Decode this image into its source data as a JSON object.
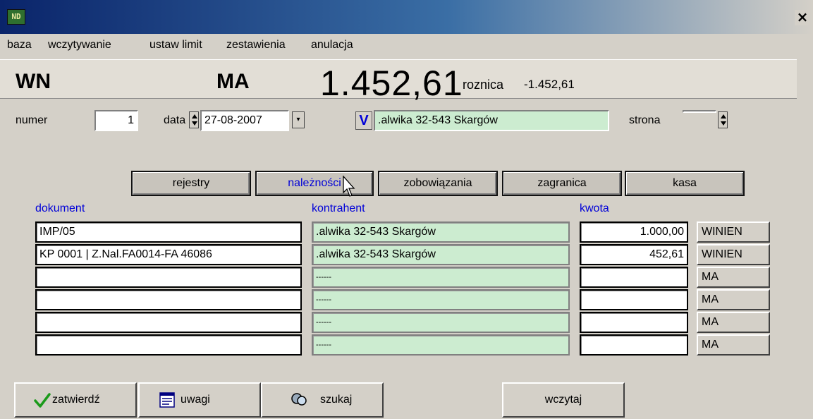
{
  "window": {
    "app_icon_text": "ND",
    "close_glyph": "×"
  },
  "menu": [
    "baza",
    "wczytywanie",
    "ustaw limit",
    "zestawienia",
    "anulacja"
  ],
  "header": {
    "wn_label": "WN",
    "ma_label": "MA",
    "total": "1.452,61",
    "roznica_label": "roznica",
    "roznica_value": "-1.452,61"
  },
  "form": {
    "numer_label": "numer",
    "numer_value": "1",
    "data_label": "data",
    "data_value": "27-08-2007",
    "v_button": "V",
    "kontrahent_value": ".alwika  32-543 Skargów",
    "strona_label": "strona",
    "strona_value": ""
  },
  "tabs": [
    "rejestry",
    "należności",
    "zobowiązania",
    "zagranica",
    "kasa"
  ],
  "columns": {
    "dokument": "dokument",
    "kontrahent": "kontrahent",
    "kwota": "kwota"
  },
  "rows": [
    {
      "dokument": "IMP/05",
      "kontrahent": ".alwika  32-543 Skargów",
      "kwota": "1.000,00",
      "side": "WINIEN"
    },
    {
      "dokument": "KP 0001 | Z.Nal.FA0014-FA 46086",
      "kontrahent": ".alwika  32-543 Skargów",
      "kwota": "452,61",
      "side": "WINIEN"
    },
    {
      "dokument": "",
      "kontrahent": "------",
      "kwota": "",
      "side": "MA"
    },
    {
      "dokument": "",
      "kontrahent": "------",
      "kwota": "",
      "side": "MA"
    },
    {
      "dokument": "",
      "kontrahent": "------",
      "kwota": "",
      "side": "MA"
    },
    {
      "dokument": "",
      "kontrahent": "------",
      "kwota": "",
      "side": "MA"
    }
  ],
  "buttons": {
    "zatwierdz": "zatwierdź",
    "uwagi": "uwagi",
    "szukaj": "szukaj",
    "wczytaj": "wczytaj"
  },
  "icons": {
    "check": "check-icon",
    "notes": "notes-icon",
    "search": "search-icon"
  },
  "colors": {
    "title_start": "#0a246a",
    "green_field": "#ccecd0",
    "blue_text": "#0000d8"
  }
}
